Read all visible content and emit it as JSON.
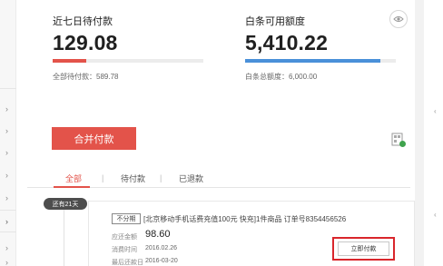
{
  "summary": {
    "week_due": {
      "title": "近七日待付款",
      "amount": "129.08",
      "total_label": "全部待付款：589.78",
      "bar_color": "#e3534a",
      "progress": 0.22
    },
    "credit": {
      "title": "白条可用额度",
      "amount": "5,410.22",
      "total_label": "白条总额度：6,000.00",
      "bar_color": "#4a90d9",
      "progress": 0.9
    }
  },
  "actions": {
    "merge_pay_label": "合并付款"
  },
  "tabs": [
    {
      "label": "全部",
      "active": true
    },
    {
      "label": "待付款",
      "active": false
    },
    {
      "label": "已退款",
      "active": false
    }
  ],
  "order": {
    "due_badge": "还有21天",
    "tag": "不分期",
    "title": "[北京移动手机话费充值100元 快充]1件商品 订单号8354456526",
    "amount_label": "应还金额",
    "amount": "98.60",
    "date_label": "消费时间",
    "date": "2016.02.26",
    "due_label": "最后还款日",
    "due": "2016-03-20",
    "pay_button": "立即付款"
  },
  "icons": {
    "eye": "eye-icon",
    "qr": "qr-icon",
    "chevron": "chevron-right-icon"
  },
  "colors": {
    "accent": "#e3534a",
    "highlight": "#d9262c",
    "credit_bar": "#4a90d9"
  }
}
